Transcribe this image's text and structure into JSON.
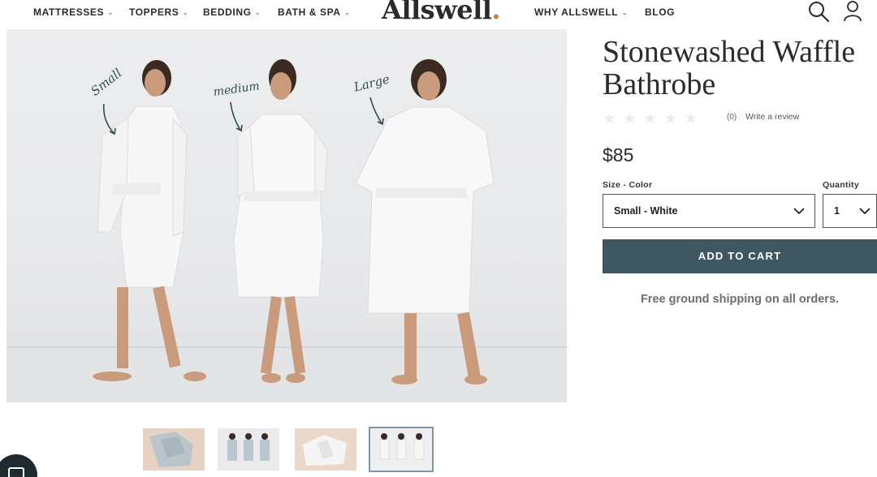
{
  "nav": {
    "items": [
      {
        "label": "MATTRESSES",
        "has_dropdown": true
      },
      {
        "label": "TOPPERS",
        "has_dropdown": true
      },
      {
        "label": "BEDDING",
        "has_dropdown": true
      },
      {
        "label": "BATH & SPA",
        "has_dropdown": true
      },
      {
        "label": "WHY ALLSWELL",
        "has_dropdown": true
      },
      {
        "label": "BLOG",
        "has_dropdown": false
      }
    ],
    "logo": "Allswell",
    "logo_dot": ".",
    "icons": [
      "search-icon",
      "account-icon",
      "chevron-down-icon"
    ]
  },
  "hero": {
    "size_annotations": [
      "Small",
      "medium",
      "Large"
    ]
  },
  "thumbnails": {
    "count": 4,
    "active_index": 3
  },
  "product": {
    "title": "Stonewashed Waffle Bathrobe",
    "rating_stars": 0,
    "rating_max": 5,
    "stars_glyphs": "★★★★★",
    "review_count": "(0)",
    "write_review": "Write a review",
    "price": "$85",
    "size_color_label": "Size - Color",
    "size_color_value": "Small - White",
    "quantity_label": "Quantity",
    "quantity_value": "1",
    "add_to_cart": "ADD TO CART",
    "shipping_note": "Free ground shipping on all orders."
  },
  "colors": {
    "button_bg": "#3f5761",
    "text_dark": "#2b2b2b",
    "logo_dot": "#c97a4a",
    "active_thumb_border": "#7f96a5"
  }
}
